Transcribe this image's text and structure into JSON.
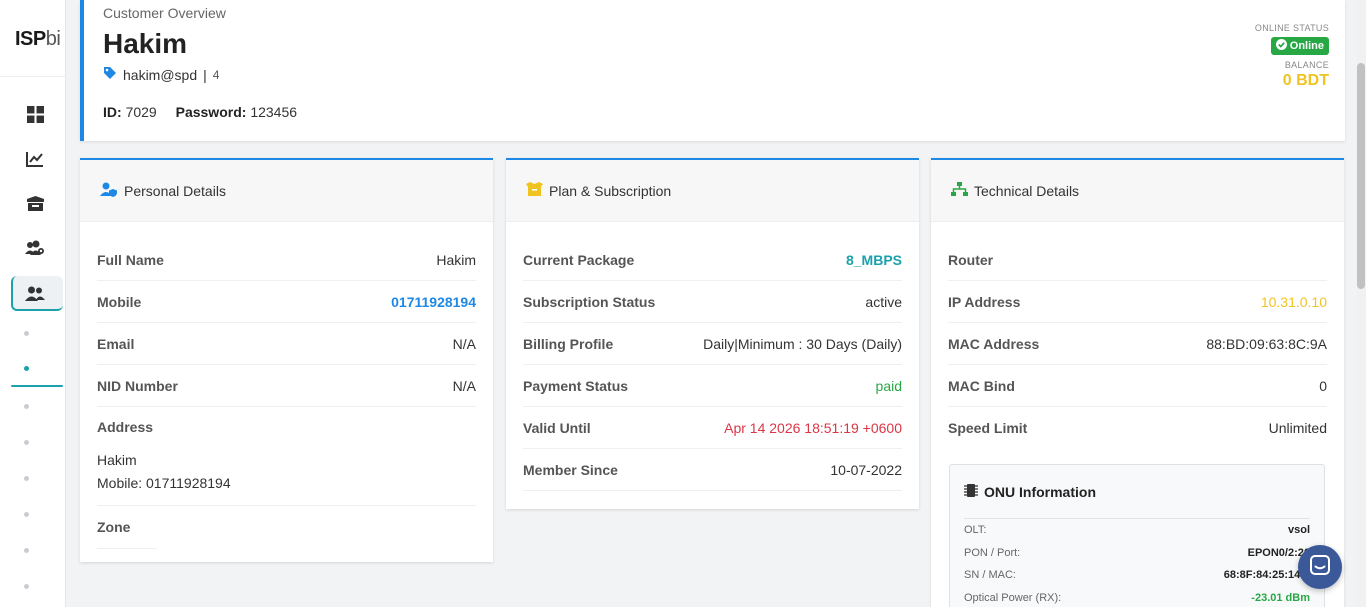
{
  "brand": {
    "logo_bold": "ISP",
    "logo_light": "bi"
  },
  "sidebar": {
    "icons": [
      "dashboard-icon",
      "chart-line-icon",
      "box-icon",
      "users-cog-icon",
      "user-friends-icon"
    ],
    "active_index": 4
  },
  "header": {
    "subtitle": "Customer Overview",
    "name": "Hakim",
    "tag": "hakim@spd",
    "tag_separator": "|",
    "tag_count": "4",
    "id_label": "ID:",
    "id_value": "7029",
    "password_label": "Password:",
    "password_value": "123456",
    "online_status_label": "ONLINE STATUS",
    "online_status_value": "Online",
    "balance_label": "BALANCE",
    "balance_value": "0 BDT"
  },
  "personal": {
    "title": "Personal Details",
    "full_name_label": "Full Name",
    "full_name": "Hakim",
    "mobile_label": "Mobile",
    "mobile": "01711928194",
    "email_label": "Email",
    "email": "N/A",
    "nid_label": "NID Number",
    "nid": "N/A",
    "address_label": "Address",
    "address_line1": "Hakim",
    "address_line2": "Mobile: 01711928194",
    "zone_label": "Zone"
  },
  "plan": {
    "title": "Plan & Subscription",
    "package_label": "Current Package",
    "package": "8_MBPS",
    "status_label": "Subscription Status",
    "status": "active",
    "billing_label": "Billing Profile",
    "billing": "Daily|Minimum : 30 Days (Daily)",
    "payment_label": "Payment Status",
    "payment": "paid",
    "valid_label": "Valid Until",
    "valid": "Apr 14 2026 18:51:19 +0600",
    "member_label": "Member Since",
    "member": "10-07-2022"
  },
  "technical": {
    "title": "Technical Details",
    "router_label": "Router",
    "router": "",
    "ip_label": "IP Address",
    "ip": "10.31.0.10",
    "mac_label": "MAC Address",
    "mac": "88:BD:09:63:8C:9A",
    "macbind_label": "MAC Bind",
    "macbind": "0",
    "speed_label": "Speed Limit",
    "speed": "Unlimited",
    "onu": {
      "title": "ONU Information",
      "olt_label": "OLT:",
      "olt": "vsol",
      "pon_label": "PON / Port:",
      "pon": "EPON0/2:26",
      "sn_label": "SN / MAC:",
      "sn": "68:8F:84:25:14:9",
      "rx_label": "Optical Power (RX):",
      "rx": "-23.01 dBm"
    }
  },
  "colors": {
    "primary": "#1e88e5",
    "teal": "#1ba1ab",
    "success": "#28a745",
    "danger": "#dc3545",
    "warning": "#f0c420"
  }
}
